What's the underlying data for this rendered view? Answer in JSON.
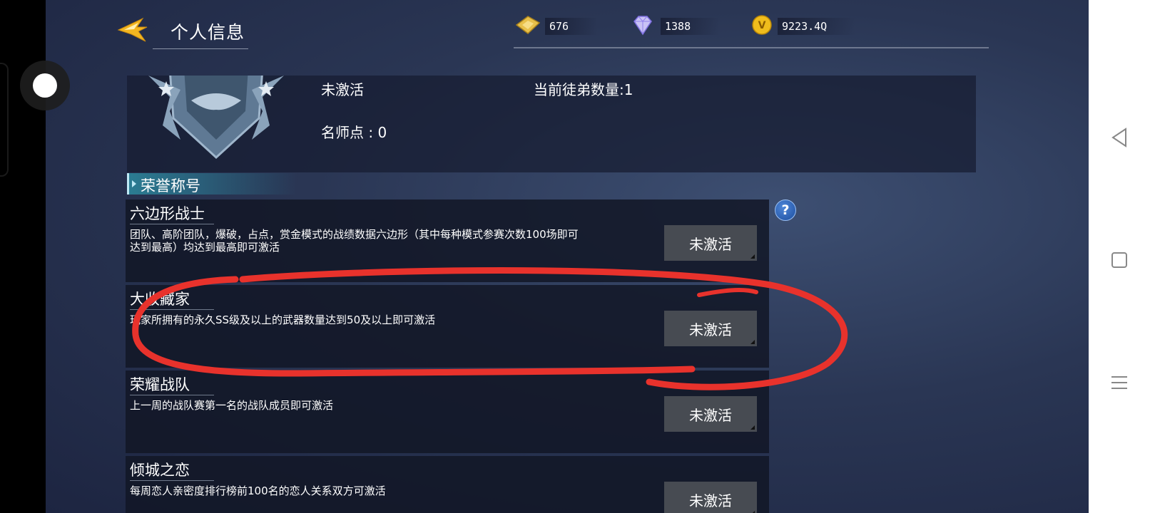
{
  "header": {
    "title": "个人信息",
    "back_icon": "back-arrow-icon"
  },
  "currencies": [
    {
      "icon": "gold-ticket-icon",
      "value": "676"
    },
    {
      "icon": "diamond-icon",
      "value": "1388"
    },
    {
      "icon": "coin-icon",
      "value": "9223.4Q"
    }
  ],
  "profile": {
    "status": "未激活",
    "apprentice_count": "当前徒弟数量:1",
    "mentor_points": "名师点 : 0"
  },
  "section": {
    "title": "荣誉称号",
    "help_label": "?"
  },
  "titles": [
    {
      "name": "六边形战士",
      "desc": "团队、高阶团队，爆破，占点，赏金模式的战绩数据六边形（其中每种模式参赛次数100场即可达到最高）均达到最高即可激活",
      "button": "未激活"
    },
    {
      "name": "大收藏家",
      "desc": "玩家所拥有的永久SS级及以上的武器数量达到50及以上即可激活",
      "button": "未激活"
    },
    {
      "name": "荣耀战队",
      "desc": "上一周的战队赛第一名的战队成员即可激活",
      "button": "未激活"
    },
    {
      "name": "倾城之恋",
      "desc": "每周恋人亲密度排行榜前100名的恋人关系双方可激活",
      "button": "未激活"
    }
  ],
  "colors": {
    "annotation_red": "#e8322c",
    "button_bg": "#474b52",
    "section_accent": "#2b7d93"
  }
}
